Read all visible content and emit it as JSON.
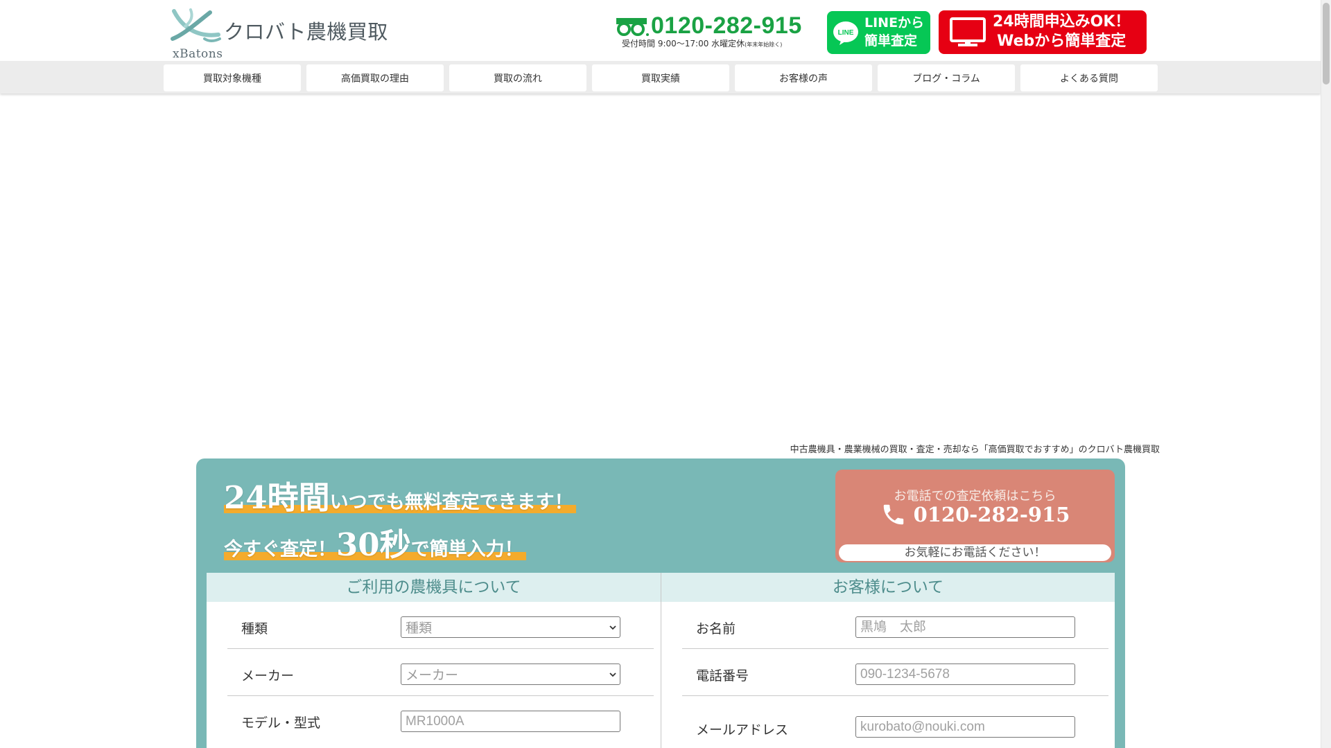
{
  "header": {
    "logo_text": "クロバト農機買取",
    "logo_sub": "xBatons",
    "phone_number": "0120-282-915",
    "phone_hours": "受付時間 9:00～17:00 水曜定休",
    "phone_hours_note": "(年末年始除く)",
    "line_button_label": "LINEから\n簡単査定",
    "line_icon_text": "LINE",
    "web_button_label": "24時間申込みOK！\nWebから簡単査定"
  },
  "nav": {
    "items": [
      {
        "label": "買取対象機種"
      },
      {
        "label": "高価買取の理由"
      },
      {
        "label": "買取の流れ"
      },
      {
        "label": "買取実績"
      },
      {
        "label": "お客様の声"
      },
      {
        "label": "ブログ・コラム"
      },
      {
        "label": "よくある質問"
      }
    ]
  },
  "tagline": "中古農機具・農業機械の買取・査定・売却なら「高価買取でおすすめ」のクロバト農機買取",
  "promo": {
    "line1_big": "24時間",
    "line1_rest": "いつでも無料査定できます！",
    "line2_pre": "今すぐ査定！",
    "line2_big": "30秒",
    "line2_post": "で簡単入力！"
  },
  "phone_card": {
    "title": "お電話での査定依頼はこちら",
    "number": "0120-282-915",
    "cta": "お気軽にお電話ください！"
  },
  "form": {
    "machine": {
      "header": "ご利用の農機具について",
      "type_label": "種類",
      "type_value": "種類",
      "maker_label": "メーカー",
      "maker_value": "メーカー",
      "model_label": "モデル・型式",
      "model_placeholder": "MR1000A"
    },
    "customer": {
      "header": "お客様について",
      "name_label": "お名前",
      "name_placeholder": "黒鳩　太郎",
      "phone_label": "電話番号",
      "phone_placeholder": "090-1234-5678",
      "email_label": "メールアドレス",
      "email_placeholder": "kurobato@nouki.com"
    }
  },
  "colors": {
    "line_green": "#06c755",
    "web_red": "#e60013",
    "panel_teal": "#79b8b6",
    "phone_card": "#d98676",
    "phone_green": "#1aa244",
    "highlight": "#f4ab2c"
  }
}
